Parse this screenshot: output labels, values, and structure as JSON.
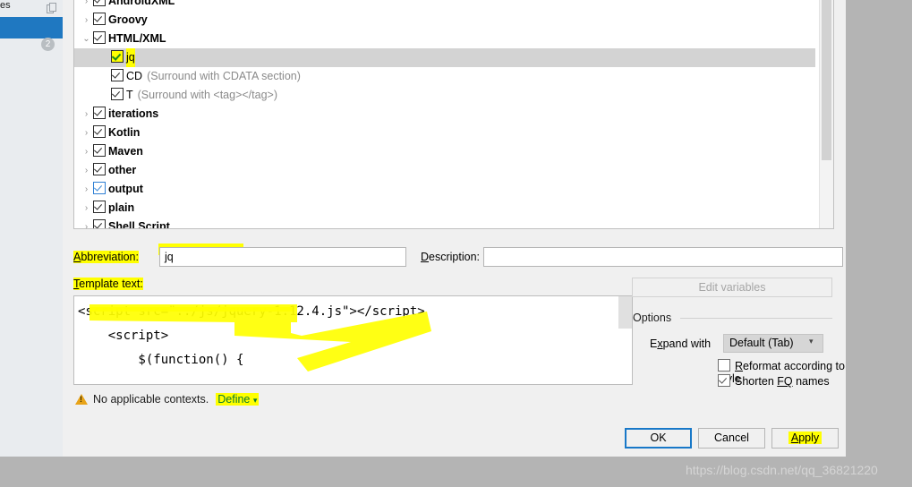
{
  "left_panel": {
    "top_label": "es",
    "icon": "copy-icon",
    "badge": "2"
  },
  "dialog": {
    "tree": {
      "rows": [
        {
          "indent": 0,
          "arrow": "collapsed",
          "checked": true,
          "label": "AndroidXML",
          "bold": true,
          "desc": "",
          "selected": false,
          "highlight": false,
          "clipped": true
        },
        {
          "indent": 0,
          "arrow": "collapsed",
          "checked": true,
          "label": "Groovy",
          "bold": true,
          "desc": "",
          "selected": false,
          "highlight": false
        },
        {
          "indent": 0,
          "arrow": "expanded",
          "checked": true,
          "label": "HTML/XML",
          "bold": true,
          "desc": "",
          "selected": false,
          "highlight": false
        },
        {
          "indent": 1,
          "arrow": "none",
          "checked": true,
          "label": "jq",
          "bold": false,
          "desc": "",
          "selected": true,
          "highlight": true
        },
        {
          "indent": 1,
          "arrow": "none",
          "checked": true,
          "label": "CD",
          "bold": false,
          "desc": "(Surround with CDATA section)",
          "selected": false,
          "highlight": false
        },
        {
          "indent": 1,
          "arrow": "none",
          "checked": true,
          "label": "T",
          "bold": false,
          "desc": "(Surround with <tag></tag>)",
          "selected": false,
          "highlight": false
        },
        {
          "indent": 0,
          "arrow": "collapsed",
          "checked": true,
          "label": "iterations",
          "bold": true,
          "desc": "",
          "selected": false,
          "highlight": false
        },
        {
          "indent": 0,
          "arrow": "collapsed",
          "checked": true,
          "label": "Kotlin",
          "bold": true,
          "desc": "",
          "selected": false,
          "highlight": false
        },
        {
          "indent": 0,
          "arrow": "collapsed",
          "checked": true,
          "label": "Maven",
          "bold": true,
          "desc": "",
          "selected": false,
          "highlight": false
        },
        {
          "indent": 0,
          "arrow": "collapsed",
          "checked": true,
          "label": "other",
          "bold": true,
          "desc": "",
          "selected": false,
          "highlight": false
        },
        {
          "indent": 0,
          "arrow": "collapsed",
          "checked": true,
          "label": "output",
          "bold": true,
          "desc": "",
          "selected": false,
          "highlight": false,
          "focused": true
        },
        {
          "indent": 0,
          "arrow": "collapsed",
          "checked": true,
          "label": "plain",
          "bold": true,
          "desc": "",
          "selected": false,
          "highlight": false
        },
        {
          "indent": 0,
          "arrow": "collapsed",
          "checked": true,
          "label": "Shell Script",
          "bold": true,
          "desc": "",
          "selected": false,
          "highlight": false,
          "clipped": true
        }
      ]
    },
    "abbreviation": {
      "label_pre": "A",
      "label_post": "bbreviation:",
      "value": "jq",
      "placeholder": ""
    },
    "description": {
      "label_pre": "D",
      "label_post": "escription:",
      "value": "",
      "placeholder": ""
    },
    "template_text": {
      "label_pre": "T",
      "label_post": "emplate text:",
      "value": "<script src=\"../js/jquery-1.12.4.js\"></script>\n    <script>\n        $(function() {"
    },
    "edit_variables_label": "Edit variables",
    "options": {
      "legend": "Options",
      "expand_with": {
        "label_pre": "E",
        "label_mid": "x",
        "label_post": "pand with",
        "selected": "Default (Tab)",
        "caret": "chevron-down-icon"
      },
      "reformat": {
        "label_pre": "",
        "label_mn": "R",
        "label_post": "eformat according to style",
        "checked": false
      },
      "shorten": {
        "label_pre": "Shorten ",
        "label_mn": "FQ",
        "label_post": " names",
        "checked": true
      }
    },
    "status": {
      "icon": "warning-icon",
      "message": "No applicable contexts.",
      "link": "Define",
      "link_caret": "chevron-down-icon"
    },
    "buttons": {
      "ok": "OK",
      "cancel": "Cancel",
      "apply_pre": "A",
      "apply_post": "pply"
    }
  },
  "watermark": "https://blog.csdn.net/qq_36821220"
}
